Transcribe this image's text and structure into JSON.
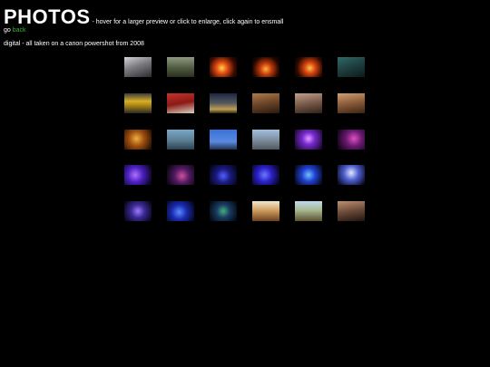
{
  "header": {
    "title": "PHOTOS",
    "tagline": " - hover for a larger preview or click to enlarge, click again to ensmall"
  },
  "nav": {
    "prefix": "go",
    "back_label": "back"
  },
  "description": "digital - all taken on a canon powershot from 2008",
  "gallery": {
    "rows": [
      [
        {
          "bg": "linear-gradient(160deg,#d4d4d4 0%,#7c7c80 45%,#2b2b30 100%)"
        },
        {
          "bg": "linear-gradient(180deg,#8e9a80 0%,#4f5a40 55%,#2a3020 100%)"
        },
        {
          "bg": "radial-gradient(circle at 45% 55%,#ffd04a 0%,#e24d12 30%,#3a0a00 70%,#0a0000 100%)"
        },
        {
          "bg": "radial-gradient(circle at 50% 60%,#ffb23a 0%,#c23a0c 32%,#200600 72%,#050000 100%)"
        },
        {
          "bg": "radial-gradient(circle at 55% 55%,#ffc04a 0%,#d6430e 30%,#2c0800 70%,#000 100%)"
        },
        {
          "bg": "linear-gradient(160deg,#2e6b6a 0%,#1f3e3f 50%,#0c1a1b 100%)"
        }
      ],
      [
        {
          "bg": "linear-gradient(180deg,#3b3b3b 0%,#d8b028 40%,#a07a10 65%,#2a2a2a 100%)"
        },
        {
          "bg": "linear-gradient(170deg,#c8322a 0%,#8a1a16 50%,#d8d0c0 100%)"
        },
        {
          "bg": "linear-gradient(180deg,#1b2540 0%,#565a60 50%,#c0a050 80%,#302818 100%)"
        },
        {
          "bg": "linear-gradient(170deg,#b07a4a 0%,#6a4428 50%,#2a1a0e 100%)"
        },
        {
          "bg": "linear-gradient(170deg,#c2a08a 0%,#7a5a4a 50%,#302018 100%)"
        },
        {
          "bg": "linear-gradient(170deg,#d0a070 0%,#8a5a3a 50%,#3a2414 100%)"
        }
      ],
      [
        {
          "bg": "radial-gradient(circle at 45% 45%,#f0b040 0%,#a05010 40%,#2a1000 90%)"
        },
        {
          "bg": "linear-gradient(180deg,#7aa8c8 0%,#5a7e90 55%,#2a4050 100%)"
        },
        {
          "bg": "linear-gradient(180deg,#3a70d8 0%,#5a8ae0 60%,#203050 100%)"
        },
        {
          "bg": "linear-gradient(180deg,#a0c0e0 0%,#8090a0 50%,#505860 100%)"
        },
        {
          "bg": "radial-gradient(circle at 50% 45%,#e0a0ff 0%,#7a2ad0 35%,#1a0830 90%)"
        },
        {
          "bg": "radial-gradient(circle at 60% 45%,#e050c0 0%,#6a1a70 40%,#14041a 90%)"
        }
      ],
      [
        {
          "bg": "radial-gradient(circle at 40% 50%,#b070ff 0%,#4a20c0 40%,#0a0420 90%)"
        },
        {
          "bg": "radial-gradient(circle at 55% 55%,#d050a0 0%,#501a60 40%,#0a0410 90%)"
        },
        {
          "bg": "radial-gradient(circle at 50% 55%,#5060ff 0%,#1a1a80 40%,#04041a 90%)"
        },
        {
          "bg": "radial-gradient(circle at 45% 50%,#6a7aff 0%,#2a20c8 40%,#06041c 90%)"
        },
        {
          "bg": "radial-gradient(circle at 50% 50%,#70c0ff 0%,#2040d0 40%,#050a22 90%)"
        },
        {
          "bg": "radial-gradient(circle at 50% 40%,#e0e8ff 0%,#5060d0 40%,#0a0a26 90%)"
        }
      ],
      [
        {
          "bg": "radial-gradient(circle at 50% 50%,#9a7aff 0%,#3a2a90 40%,#0a0620 90%)"
        },
        {
          "bg": "radial-gradient(circle at 45% 55%,#5a8aff 0%,#1a2ab0 40%,#04061c 90%)"
        },
        {
          "bg": "radial-gradient(circle at 50% 50%,#40b080 0%,#1a3a60 40%,#040a14 90%)"
        },
        {
          "bg": "linear-gradient(180deg,#f0e8d0 0%,#d0a060 45%,#6a4020 100%)"
        },
        {
          "bg": "linear-gradient(180deg,#c0d8f0 0%,#a8b890 45%,#5a5030 100%)"
        },
        {
          "bg": "linear-gradient(170deg,#c09070 0%,#6a4a38 50%,#201410 100%)"
        }
      ]
    ]
  }
}
